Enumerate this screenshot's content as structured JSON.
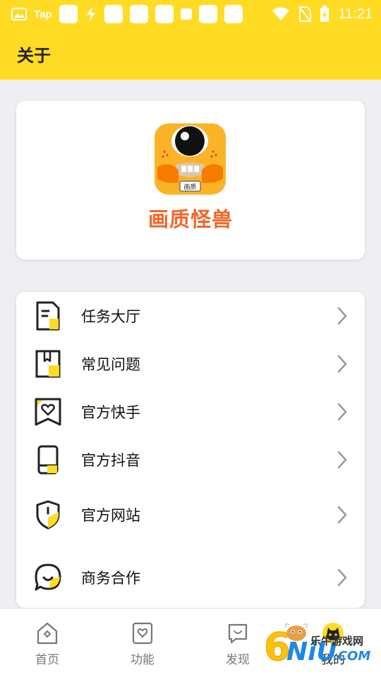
{
  "status_bar": {
    "carrier_text": "Tap",
    "time": "11:21"
  },
  "header": {
    "title": "关于"
  },
  "app": {
    "name": "画质怪兽",
    "logo_badge": "画质",
    "name_color": "#F0662A"
  },
  "menu": {
    "items": [
      {
        "label": "任务大厅",
        "icon": "task-hall-icon"
      },
      {
        "label": "常见问题",
        "icon": "faq-book-icon"
      },
      {
        "label": "官方快手",
        "icon": "kuaishou-icon"
      },
      {
        "label": "官方抖音",
        "icon": "douyin-phone-icon"
      },
      {
        "label": "官方网站",
        "icon": "website-shield-icon"
      },
      {
        "label": "商务合作",
        "icon": "business-chat-icon"
      }
    ]
  },
  "bottom_nav": {
    "tabs": [
      {
        "label": "首页",
        "icon": "home-icon"
      },
      {
        "label": "功能",
        "icon": "function-icon"
      },
      {
        "label": "发现",
        "icon": "discover-icon"
      },
      {
        "label": "我的",
        "icon": "profile-icon"
      }
    ]
  },
  "watermark": {
    "text": "乐牛游戏网"
  },
  "colors": {
    "accent": "#FFDB24",
    "background": "#EFEFF3"
  }
}
